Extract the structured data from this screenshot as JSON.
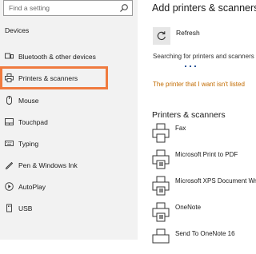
{
  "sidebar": {
    "search_placeholder": "Find a setting",
    "section_title": "Devices",
    "items": [
      {
        "label": "Bluetooth & other devices",
        "icon": "bluetooth-icon"
      },
      {
        "label": "Printers & scanners",
        "icon": "printer-icon",
        "selected": true
      },
      {
        "label": "Mouse",
        "icon": "mouse-icon"
      },
      {
        "label": "Touchpad",
        "icon": "touchpad-icon"
      },
      {
        "label": "Typing",
        "icon": "keyboard-icon"
      },
      {
        "label": "Pen & Windows Ink",
        "icon": "pen-icon"
      },
      {
        "label": "AutoPlay",
        "icon": "autoplay-icon"
      },
      {
        "label": "USB",
        "icon": "usb-icon"
      }
    ]
  },
  "main": {
    "title": "Add printers & scanners",
    "refresh_label": "Refresh",
    "status_text": "Searching for printers and scanners",
    "link_text": "The printer that I want isn't listed",
    "section_title": "Printers & scanners",
    "printers": [
      {
        "label": "Fax"
      },
      {
        "label": "Microsoft Print to PDF"
      },
      {
        "label": "Microsoft XPS Document Writer"
      },
      {
        "label": "OneNote"
      },
      {
        "label": "Send To OneNote 16"
      }
    ]
  },
  "colors": {
    "accent_highlight": "#f07b3f",
    "link": "#c26b00",
    "sidebar_bg": "#f2f2f2"
  }
}
